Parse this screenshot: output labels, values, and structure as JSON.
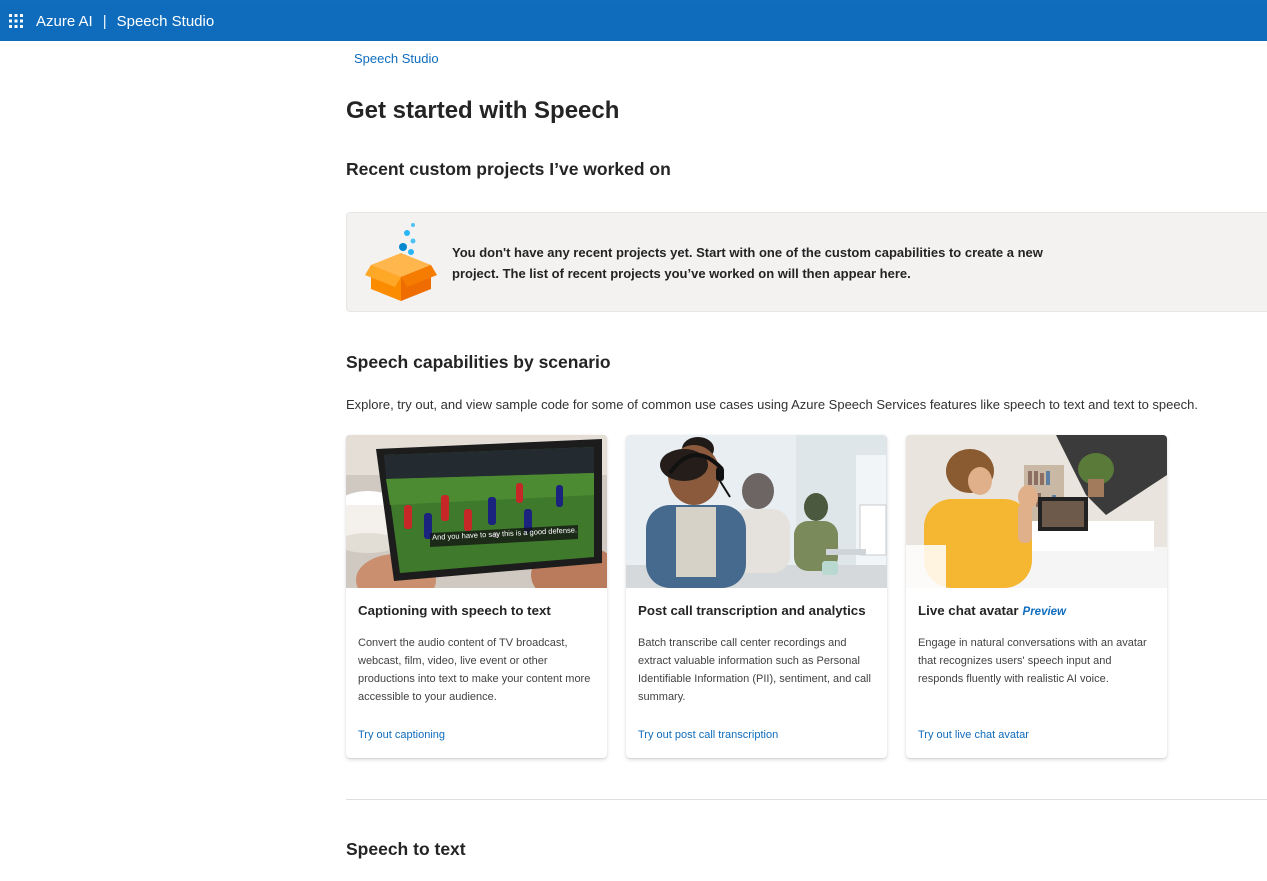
{
  "header": {
    "brand_primary": "Azure AI",
    "separator": "|",
    "brand_app": "Speech Studio",
    "bg_color": "#0f6cbd"
  },
  "breadcrumb": {
    "label": "Speech Studio"
  },
  "page": {
    "title": "Get started with Speech",
    "recent": {
      "heading": "Recent custom projects I’ve worked on",
      "empty_message": "You don't have any recent projects yet. Start with one of the custom capabilities to create a new project. The list of recent projects you’ve worked on will then appear here."
    },
    "scenarios": {
      "heading": "Speech capabilities by scenario",
      "description": "Explore, try out, and view sample code for some of common use cases using Azure Speech Services features like speech to text and text to speech.",
      "cards": [
        {
          "title": "Captioning with speech to text",
          "badge": "",
          "caption_overlay": "And you have to say this is a good defense.",
          "description": "Convert the audio content of TV broadcast, webcast, film, video, live event or other productions into text to make your content more accessible to your audience.",
          "link": "Try out captioning"
        },
        {
          "title": "Post call transcription and analytics",
          "badge": "",
          "description": "Batch transcribe call center recordings and extract valuable information such as Personal Identifiable Information (PII), sentiment, and call summary.",
          "link": "Try out post call transcription"
        },
        {
          "title": "Live chat avatar",
          "badge": "Preview",
          "description": "Engage in natural conversations with an avatar that recognizes users' speech input and responds fluently with realistic AI voice.",
          "link": "Try out live chat avatar"
        }
      ]
    },
    "speech_to_text": {
      "heading": "Speech to text"
    }
  },
  "colors": {
    "accent": "#0f6cbd",
    "box_bg": "#f3f2f1",
    "heading": "#242424"
  }
}
